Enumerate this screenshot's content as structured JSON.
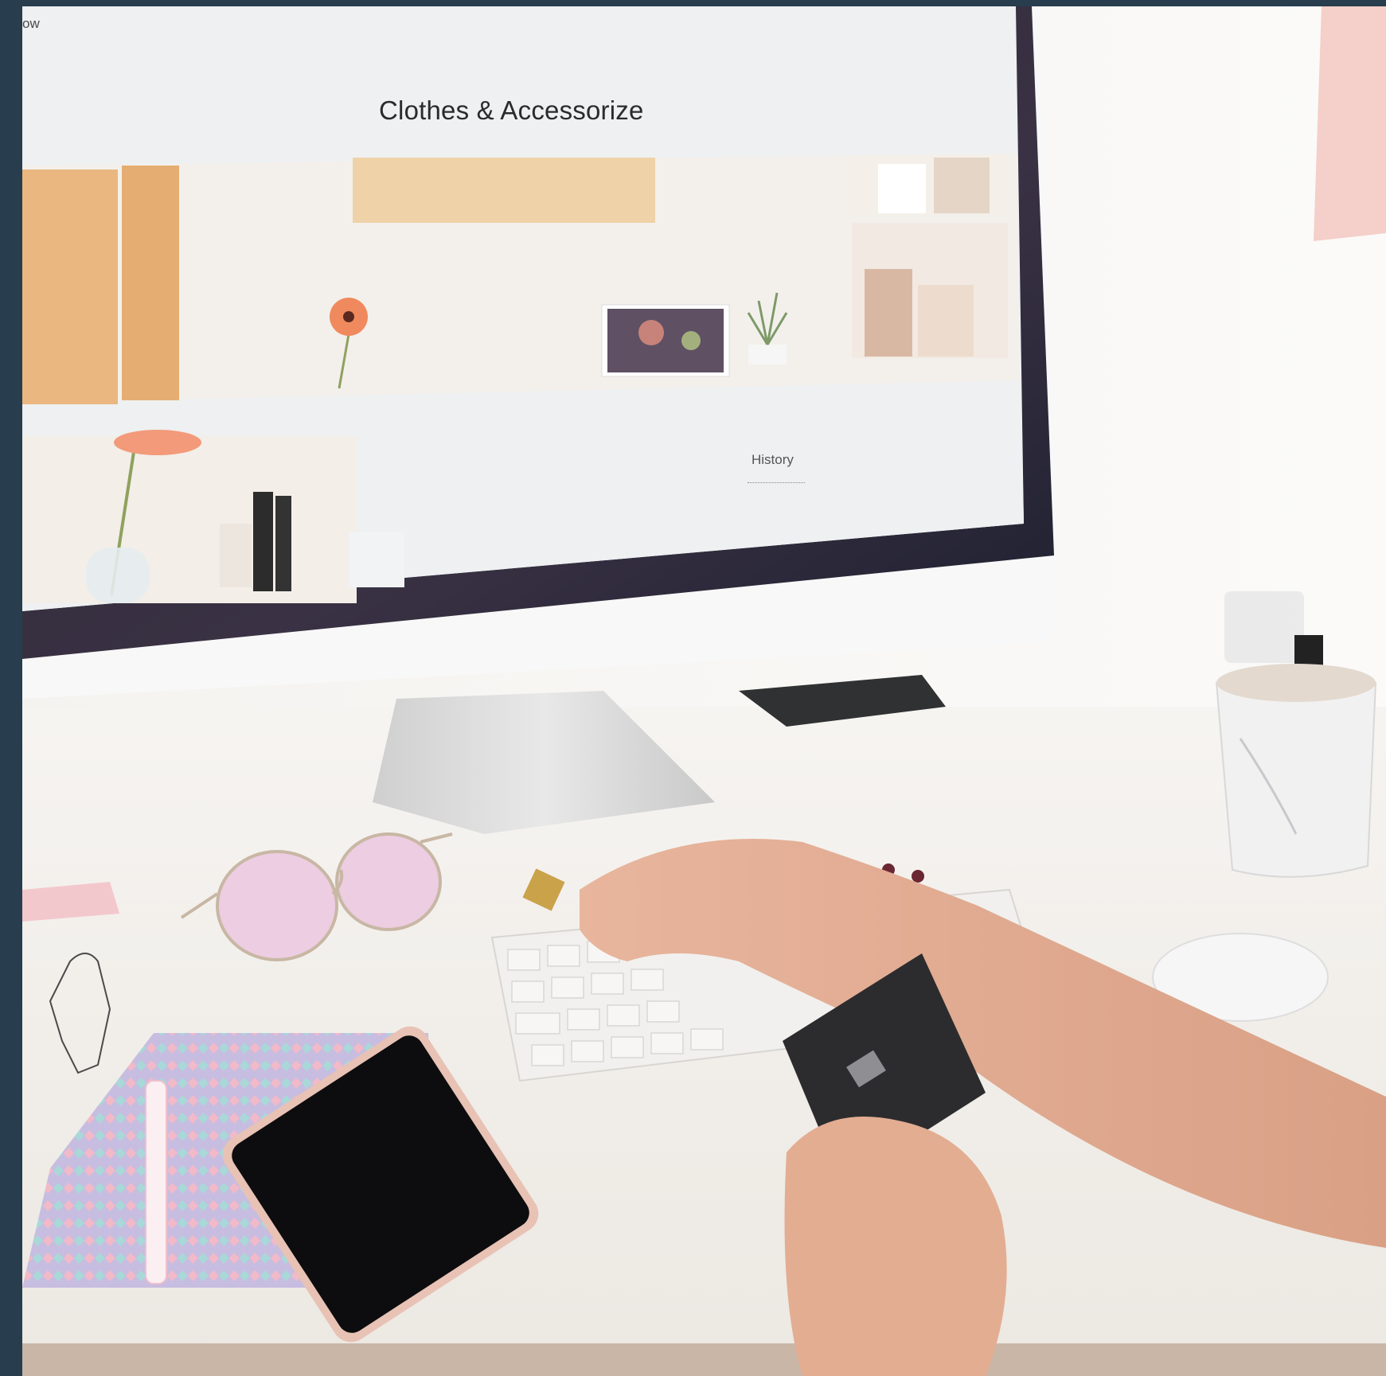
{
  "screen": {
    "corner_text": "ow",
    "title": "Clothes & Accessorize",
    "section_label": "History"
  },
  "colors": {
    "outer_border": "#283d4d",
    "desk": "#f4f2ef",
    "screen_bg": "#eef0f1",
    "peach": "#efc79a",
    "glasses_tint": "#e9c8e0",
    "card": "#2c2c2e"
  }
}
